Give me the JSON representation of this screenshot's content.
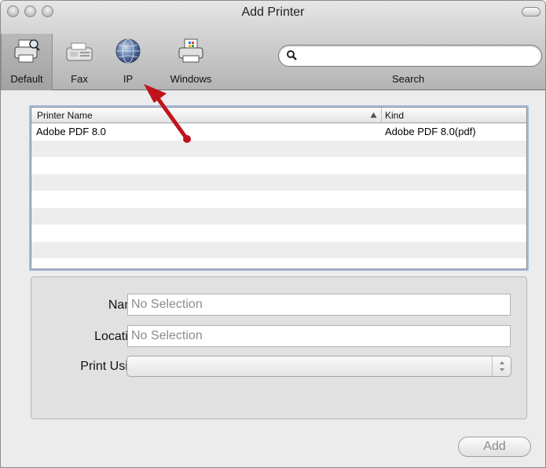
{
  "window": {
    "title": "Add Printer"
  },
  "toolbar": {
    "tools": [
      {
        "label": "Default",
        "icon": "printer-magnifier-icon",
        "selected": true
      },
      {
        "label": "Fax",
        "icon": "fax-icon",
        "selected": false
      },
      {
        "label": "IP",
        "icon": "globe-icon",
        "selected": false
      },
      {
        "label": "Windows",
        "icon": "windows-printer-icon",
        "selected": false
      }
    ],
    "search": {
      "label": "Search",
      "value": "",
      "placeholder": ""
    }
  },
  "printer_list": {
    "columns": {
      "name": "Printer Name",
      "kind": "Kind"
    },
    "rows": [
      {
        "name": "Adobe PDF 8.0",
        "kind": "Adobe PDF 8.0(pdf)"
      },
      {
        "name": "",
        "kind": ""
      },
      {
        "name": "",
        "kind": ""
      },
      {
        "name": "",
        "kind": ""
      },
      {
        "name": "",
        "kind": ""
      },
      {
        "name": "",
        "kind": ""
      },
      {
        "name": "",
        "kind": ""
      },
      {
        "name": "",
        "kind": ""
      },
      {
        "name": "",
        "kind": ""
      }
    ]
  },
  "details": {
    "name_label": "Name:",
    "name_value": "No Selection",
    "location_label": "Location:",
    "location_value": "No Selection",
    "print_using_label": "Print Using:",
    "print_using_value": ""
  },
  "footer": {
    "add_label": "Add"
  },
  "colors": {
    "annotation_arrow": "#c0141c",
    "selection_ring": "#a7bfe0"
  }
}
